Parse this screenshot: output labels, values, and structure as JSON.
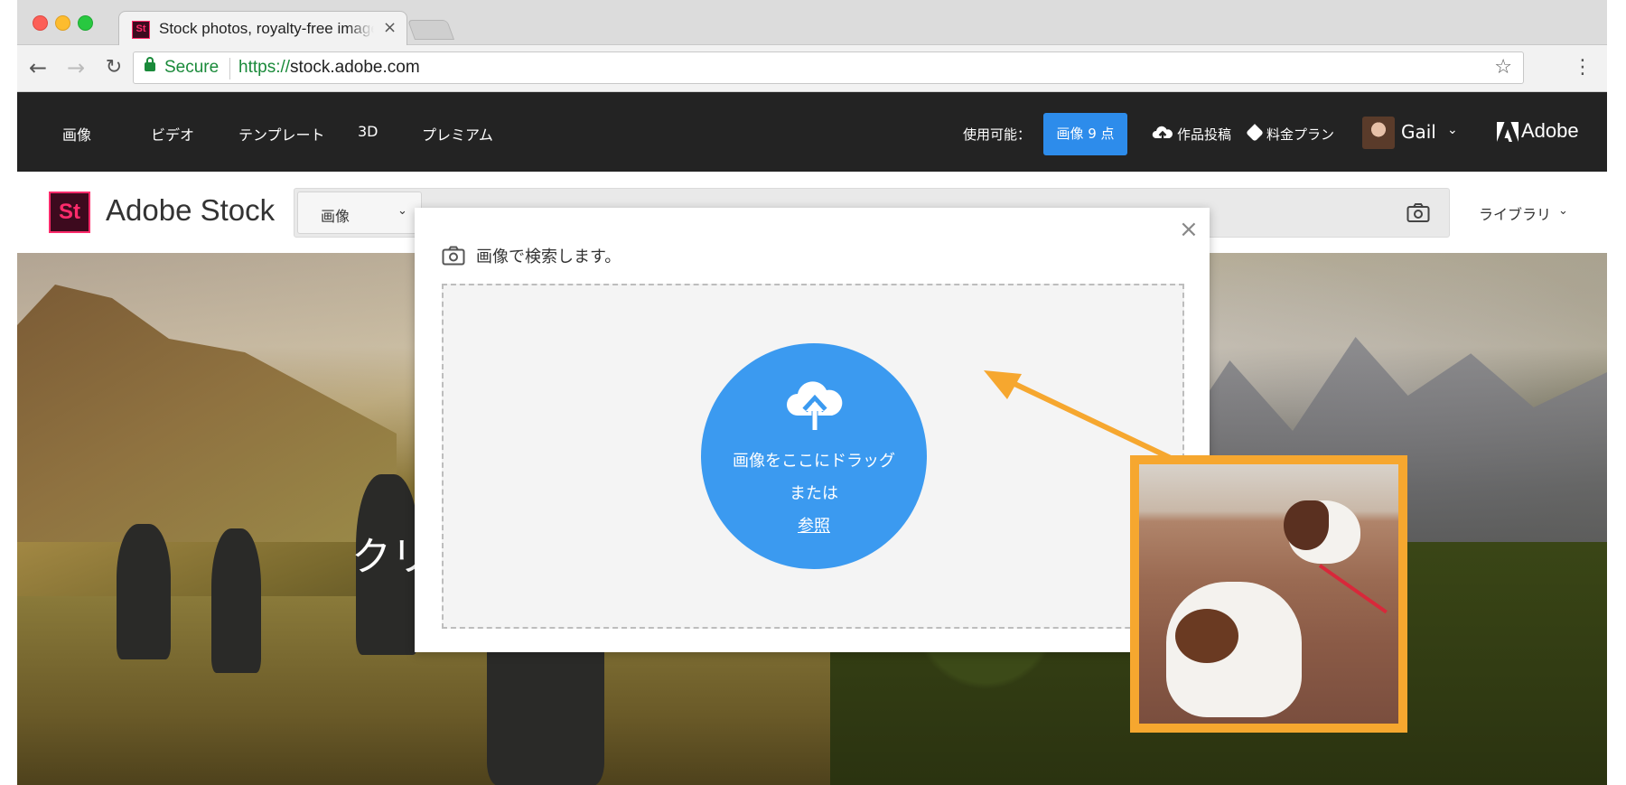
{
  "browser": {
    "tab_title": "Stock photos, royalty-free images",
    "tab_favicon_text": "St",
    "tab_close": "×",
    "secure_label": "Secure",
    "url_scheme": "https://",
    "url_host": "stock.adobe.com"
  },
  "topnav": {
    "items": [
      "画像",
      "ビデオ",
      "テンプレート",
      "3D",
      "プレミアム"
    ],
    "available_label": "使用可能：",
    "available_badge": "画像 9 点",
    "upload_label": "作品投稿",
    "pricing_label": "料金プラン",
    "user_name": "Gail",
    "brand": "Adobe"
  },
  "stock_header": {
    "logo_text": "St",
    "product_name": "Adobe Stock",
    "search_type": "画像",
    "search_placeholder": "",
    "library_label": "ライブラリ"
  },
  "hero": {
    "title_partial": "クリ"
  },
  "modal": {
    "title": "画像で検索します。",
    "close": "×",
    "drop_line1": "画像をここにドラッグ",
    "drop_line2": "または",
    "browse_link": "参照"
  },
  "colors": {
    "accent_blue": "#3b9af0",
    "badge_blue": "#2d8ceb",
    "callout_orange": "#f6a72f",
    "dark_bar": "#232323",
    "stock_pink": "#ff2b6b"
  }
}
